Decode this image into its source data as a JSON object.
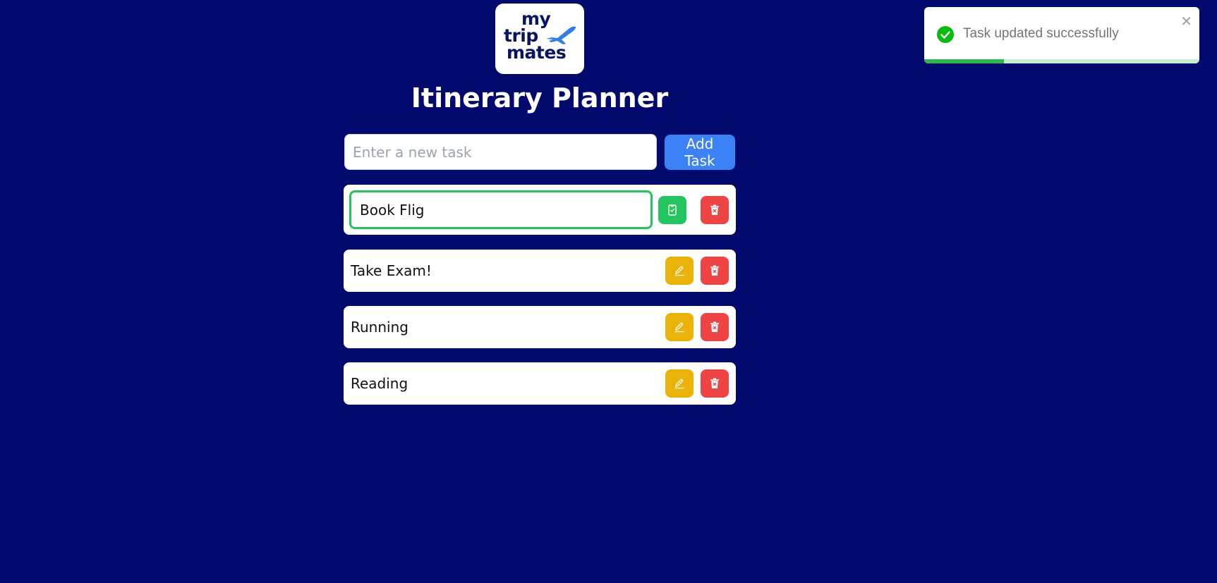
{
  "logo": {
    "line1": "my",
    "line2": "trip",
    "line3": "mates",
    "icon": "plane-icon",
    "color": "#0b1363",
    "accent": "#2f7fe8"
  },
  "header": {
    "title": "Itinerary Planner"
  },
  "new_task": {
    "placeholder": "Enter a new task",
    "value": "",
    "add_label": "Add Task"
  },
  "tasks": [
    {
      "label": "Book Flig",
      "editing": true,
      "actions": [
        "save-icon",
        "delete-icon"
      ]
    },
    {
      "label": "Take Exam!",
      "editing": false,
      "actions": [
        "pencil-icon",
        "delete-icon"
      ]
    },
    {
      "label": "Running",
      "editing": false,
      "actions": [
        "pencil-icon",
        "delete-icon"
      ]
    },
    {
      "label": "Reading",
      "editing": false,
      "actions": [
        "pencil-icon",
        "delete-icon"
      ]
    }
  ],
  "toast": {
    "message": "Task updated successfully",
    "status": "success",
    "close_icon": "close-icon",
    "progress": 0.29
  },
  "colors": {
    "background": "#020b6d",
    "add_button": "#3b82f6",
    "save_button": "#22c55e",
    "edit_button": "#eab308",
    "delete_button": "#ef4444",
    "toast_success": "#2fb84f"
  }
}
